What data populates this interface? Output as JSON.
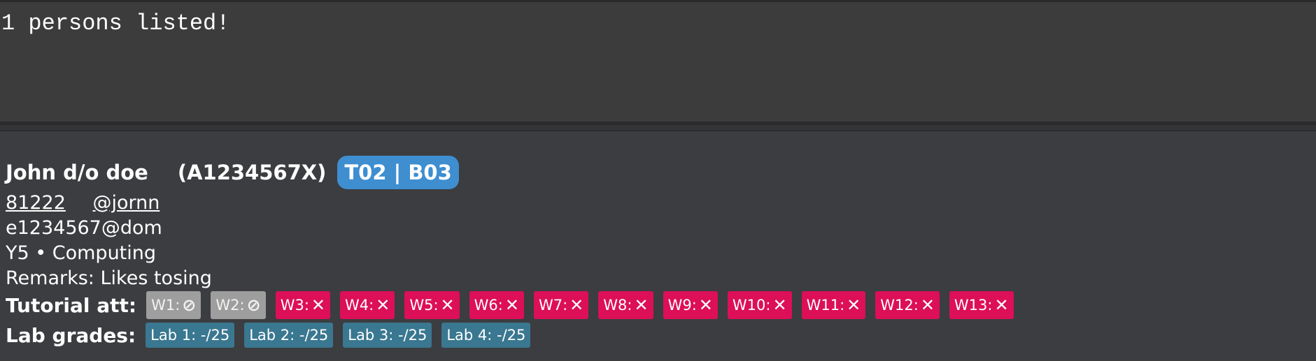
{
  "result": {
    "text": "1 persons listed!"
  },
  "person": {
    "name": "John d/o doe",
    "student_id": "(A1234567X)",
    "group": "T02 | B03",
    "phone": "81222",
    "telegram": "@jornn",
    "email": "e1234567@dom",
    "year_major": "Y5  •  Computing",
    "remarks": "Remarks: Likes tosing",
    "tutorial_label": "Tutorial att:",
    "tutorial": [
      {
        "week": "W1:",
        "status": "excused",
        "icon": "⊘"
      },
      {
        "week": "W2:",
        "status": "excused",
        "icon": "⊘"
      },
      {
        "week": "W3:",
        "status": "absent",
        "icon": "✕"
      },
      {
        "week": "W4:",
        "status": "absent",
        "icon": "✕"
      },
      {
        "week": "W5:",
        "status": "absent",
        "icon": "✕"
      },
      {
        "week": "W6:",
        "status": "absent",
        "icon": "✕"
      },
      {
        "week": "W7:",
        "status": "absent",
        "icon": "✕"
      },
      {
        "week": "W8:",
        "status": "absent",
        "icon": "✕"
      },
      {
        "week": "W9:",
        "status": "absent",
        "icon": "✕"
      },
      {
        "week": "W10:",
        "status": "absent",
        "icon": "✕"
      },
      {
        "week": "W11:",
        "status": "absent",
        "icon": "✕"
      },
      {
        "week": "W12:",
        "status": "absent",
        "icon": "✕"
      },
      {
        "week": "W13:",
        "status": "absent",
        "icon": "✕"
      }
    ],
    "lab_label": "Lab grades:",
    "labs": [
      "Lab 1: -/25",
      "Lab 2: -/25",
      "Lab 3: -/25",
      "Lab 4: -/25"
    ]
  },
  "colors": {
    "group_badge": "#3e8ed0",
    "absent": "#dc0f57",
    "excused": "#9e9e9e",
    "lab": "#3a7790"
  }
}
